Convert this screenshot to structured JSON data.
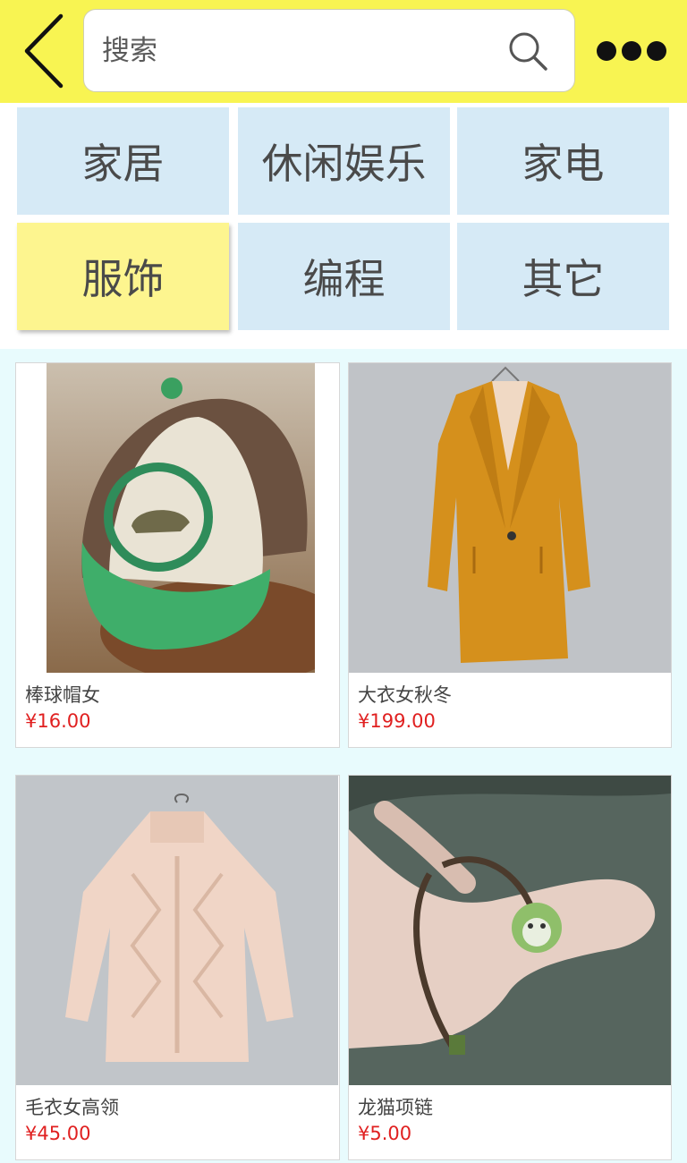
{
  "header": {
    "search_placeholder": "搜索",
    "back_icon": "chevron-left-icon",
    "search_icon": "search-icon",
    "more_icon": "more-dots-icon",
    "bg_color": "#f8f452"
  },
  "categories": [
    {
      "label": "家居",
      "active": false
    },
    {
      "label": "休闲娱乐",
      "active": false
    },
    {
      "label": "家电",
      "active": false
    },
    {
      "label": "服饰",
      "active": true
    },
    {
      "label": "编程",
      "active": false
    },
    {
      "label": "其它",
      "active": false
    }
  ],
  "colors": {
    "category_bg": "#d6eaf6",
    "category_active_bg": "#fdf58f",
    "products_bg": "#e8fbfd",
    "price": "#e02020"
  },
  "products": [
    {
      "name": "棒球帽女",
      "price": "¥16.00",
      "image": "baseball-cap-photo"
    },
    {
      "name": "大衣女秋冬",
      "price": "¥199.00",
      "image": "mustard-coat-photo"
    },
    {
      "name": "毛衣女高领",
      "price": "¥45.00",
      "image": "turtleneck-sweater-photo"
    },
    {
      "name": "龙猫项链",
      "price": "¥5.00",
      "image": "totoro-necklace-photo"
    }
  ]
}
